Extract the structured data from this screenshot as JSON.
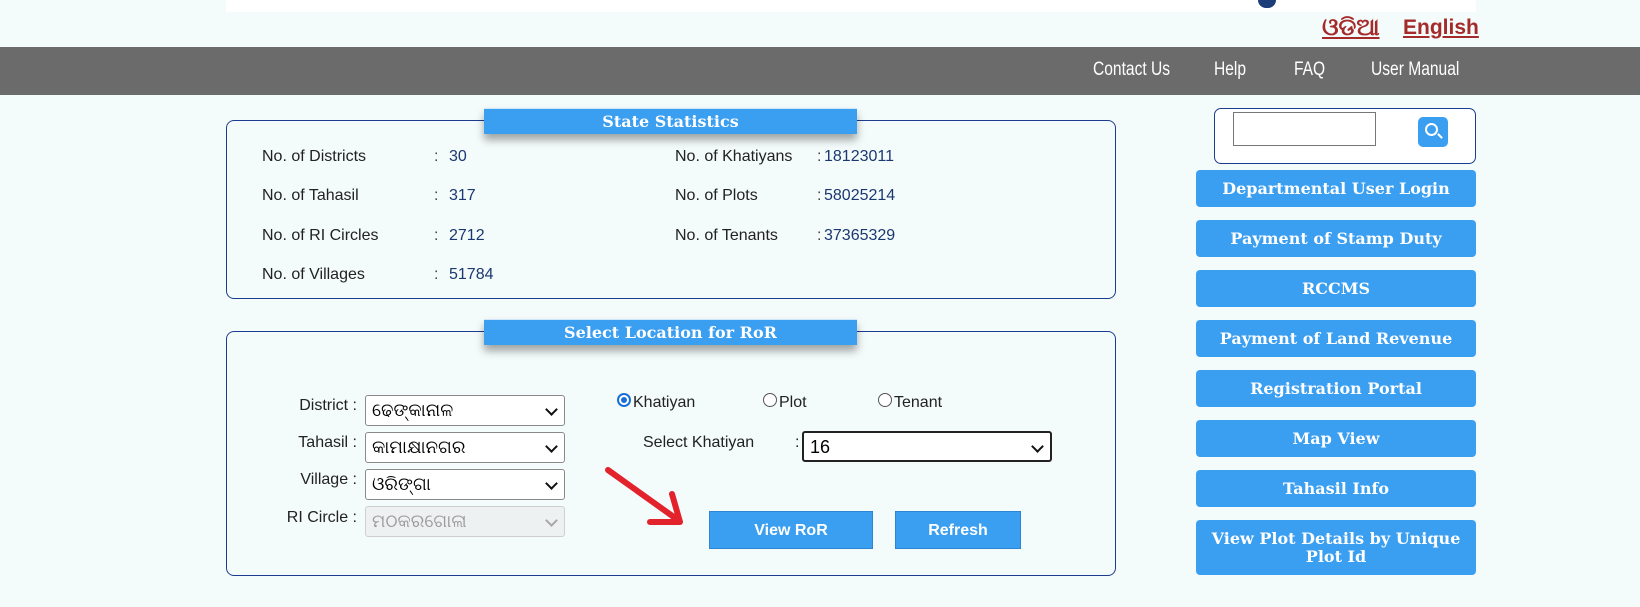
{
  "header": {
    "lang_odia": "ଓଡିଆ",
    "lang_english": "English"
  },
  "nav": {
    "contact_us": "Contact Us",
    "help": "Help",
    "faq": "FAQ",
    "user_manual": "User Manual"
  },
  "stats": {
    "title": "State Statistics",
    "colon": ":",
    "left": [
      {
        "label": "No. of Districts",
        "value": "30"
      },
      {
        "label": "No. of Tahasil",
        "value": "317"
      },
      {
        "label": "No. of RI Circles",
        "value": "2712"
      },
      {
        "label": "No. of Villages",
        "value": "51784"
      }
    ],
    "right": [
      {
        "label": "No. of Khatiyans",
        "value": "18123011"
      },
      {
        "label": "No. of Plots",
        "value": "58025214"
      },
      {
        "label": "No. of Tenants",
        "value": "37365329"
      }
    ]
  },
  "location": {
    "title": "Select Location for RoR",
    "fields": [
      {
        "label": "District :",
        "value": "ଢେଙ୍କାନାଳ"
      },
      {
        "label": "Tahasil :",
        "value": "କାମାକ୍ଷାନଗର"
      },
      {
        "label": "Village :",
        "value": "ଓରିଙ୍ଗା"
      },
      {
        "label": "RI Circle :",
        "value": "ମଠକରଗୋଳା"
      }
    ],
    "radios": {
      "khatiyan": "Khatiyan",
      "plot": "Plot",
      "tenant": "Tenant",
      "selected": "Khatiyan"
    },
    "select_khatiyan_label": "Select Khatiyan",
    "select_khatiyan_colon": ":",
    "select_khatiyan_value": "16",
    "view_ror": "View RoR",
    "refresh": "Refresh"
  },
  "sidebar": {
    "search_value": "",
    "buttons": [
      "Departmental User Login",
      "Payment of Stamp Duty",
      "RCCMS",
      "Payment of Land Revenue",
      "Registration Portal",
      "Map View",
      "Tahasil Info",
      "View Plot Details by Unique Plot Id"
    ]
  },
  "colors": {
    "accent": "#3a9ef1",
    "navbar": "#6b6b6b",
    "link": "#a52a2a",
    "annotation_arrow": "#e3232c"
  }
}
